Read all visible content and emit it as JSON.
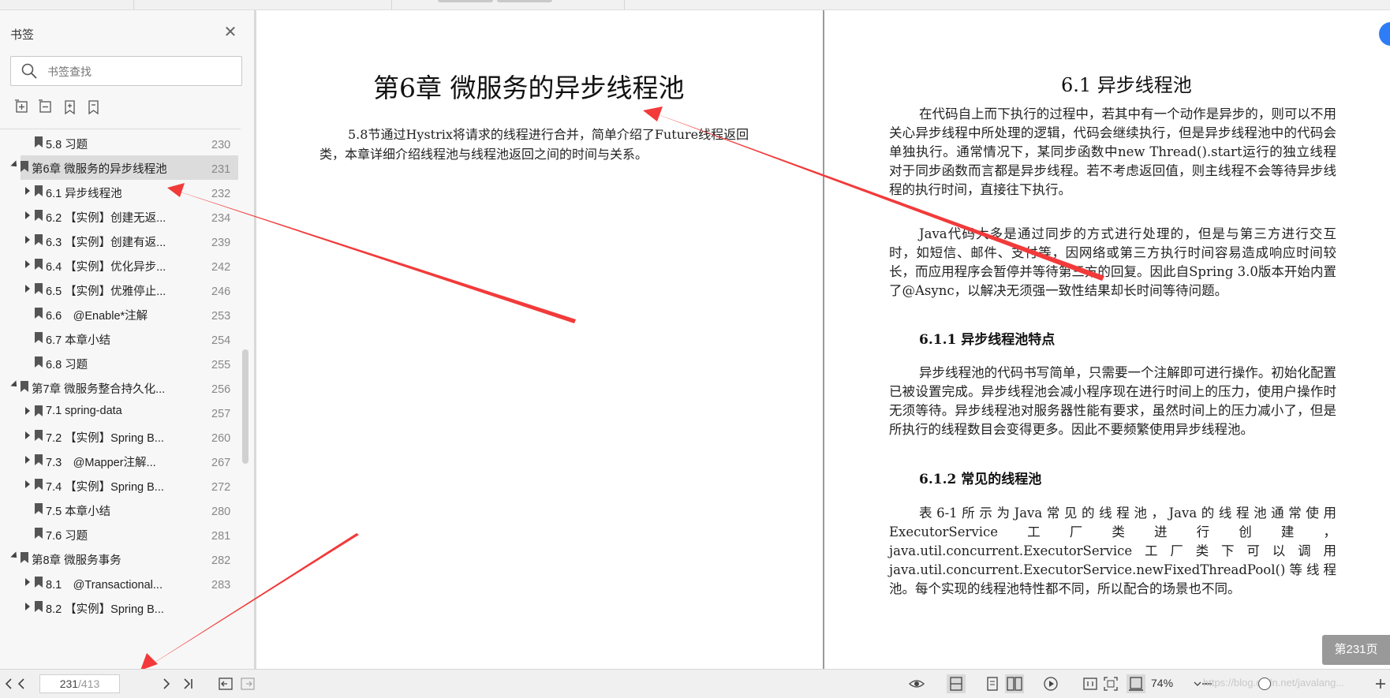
{
  "sidebar": {
    "title": "书签",
    "search_placeholder": "书签查找",
    "items": [
      {
        "label": "5.8 习题",
        "page": "230",
        "level": 1,
        "expand": "none"
      },
      {
        "label": "第6章 微服务的异步线程池",
        "page": "231",
        "level": 0,
        "expand": "open",
        "selected": true
      },
      {
        "label": "6.1 异步线程池",
        "page": "232",
        "level": 1,
        "expand": "closed"
      },
      {
        "label": "6.2 【实例】创建无返...",
        "page": "234",
        "level": 1,
        "expand": "closed"
      },
      {
        "label": "6.3 【实例】创建有返...",
        "page": "239",
        "level": 1,
        "expand": "closed"
      },
      {
        "label": "6.4 【实例】优化异步...",
        "page": "242",
        "level": 1,
        "expand": "closed"
      },
      {
        "label": "6.5 【实例】优雅停止...",
        "page": "246",
        "level": 1,
        "expand": "closed"
      },
      {
        "label": "6.6　@Enable*注解",
        "page": "253",
        "level": 1,
        "expand": "none"
      },
      {
        "label": "6.7 本章小结",
        "page": "254",
        "level": 1,
        "expand": "none"
      },
      {
        "label": "6.8 习题",
        "page": "255",
        "level": 1,
        "expand": "none"
      },
      {
        "label": "第7章 微服务整合持久化...",
        "page": "256",
        "level": 0,
        "expand": "open"
      },
      {
        "label": "7.1 spring-data",
        "page": "257",
        "level": 1,
        "expand": "closed"
      },
      {
        "label": "7.2 【实例】Spring B...",
        "page": "260",
        "level": 1,
        "expand": "closed"
      },
      {
        "label": "7.3　@Mapper注解...",
        "page": "267",
        "level": 1,
        "expand": "closed"
      },
      {
        "label": "7.4 【实例】Spring B...",
        "page": "272",
        "level": 1,
        "expand": "closed"
      },
      {
        "label": "7.5 本章小结",
        "page": "280",
        "level": 1,
        "expand": "none"
      },
      {
        "label": "7.6 习题",
        "page": "281",
        "level": 1,
        "expand": "none"
      },
      {
        "label": "第8章 微服务事务",
        "page": "282",
        "level": 0,
        "expand": "open"
      },
      {
        "label": "8.1　@Transactional...",
        "page": "283",
        "level": 1,
        "expand": "closed"
      },
      {
        "label": "8.2 【实例】Spring B...",
        "page": "",
        "level": 1,
        "expand": "closed"
      }
    ]
  },
  "left_page": {
    "chapter_title": "第6章  微服务的异步线程池",
    "intro": "5.8节通过Hystrix将请求的线程进行合并，简单介绍了Future线程返回类，本章详细介绍线程池与线程池返回之间的时间与关系。"
  },
  "right_page": {
    "section_title": "6.1  异步线程池",
    "para1": "在代码自上而下执行的过程中，若其中有一个动作是异步的，则可以不用关心异步线程中所处理的逻辑，代码会继续执行，但是异步线程池中的代码会单独执行。通常情况下，某同步函数中new Thread().start运行的独立线程对于同步函数而言都是异步线程。若不考虑返回值，则主线程不会等待异步线程的执行时间，直接往下执行。",
    "para2": "Java代码大多是通过同步的方式进行处理的，但是与第三方进行交互时，如短信、邮件、支付等，因网络或第三方执行时间容易造成响应时间较长，而应用程序会暂停并等待第三方的回复。因此自Spring 3.0版本开始内置了@Async，以解决无须强一致性结果却长时间等待问题。",
    "sub1": "6.1.1  异步线程池特点",
    "para3": "异步线程池的代码书写简单，只需要一个注解即可进行操作。初始化配置已被设置完成。异步线程池会减小程序现在进行时间上的压力，使用户操作时无须等待。异步线程池对服务器性能有要求，虽然时间上的压力减小了，但是所执行的线程数目会变得更多。因此不要频繁使用异步线程池。",
    "sub2": "6.1.2  常见的线程池",
    "para4": "表6-1所示为Java常见的线程池，Java的线程池通常使用ExecutorService工厂类进行创建，java.util.concurrent.ExecutorService工厂类下可以调用java.util.concurrent.ExecutorService.newFixedThreadPool()等线程池。每个实现的线程池特性都不同，所以配合的场景也不同。"
  },
  "page_badge": "第231页",
  "statusbar": {
    "current_page": "231",
    "total_pages": "/413",
    "zoom": "74%",
    "watermark": "https://blog.csdn.net/javalang..."
  },
  "colors": {
    "arrow": "#f23a3a",
    "selected_row": "#dcdcdc",
    "badge": "#8f8f8f"
  }
}
